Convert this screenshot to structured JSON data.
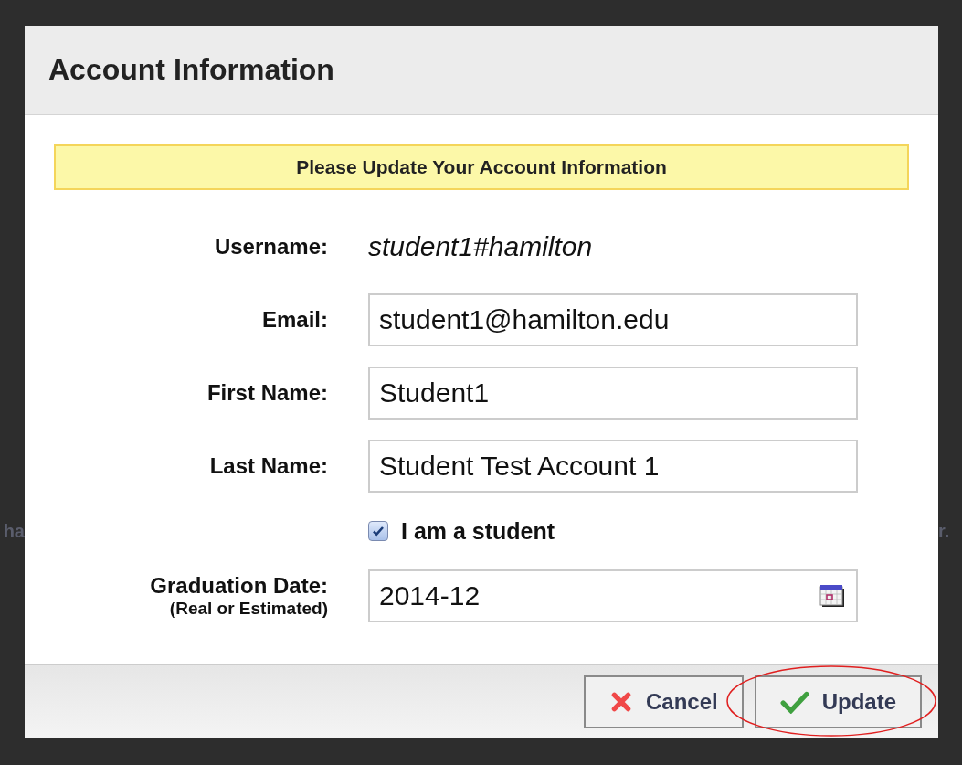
{
  "background_fragments": {
    "left": "ha",
    "right": "r."
  },
  "dialog": {
    "title": "Account Information",
    "notice": "Please Update Your Account Information",
    "fields": [
      {
        "kind": "static",
        "label": "Username:",
        "value": "student1#hamilton"
      },
      {
        "kind": "input",
        "label": "Email:",
        "value": "student1@hamilton.edu"
      },
      {
        "kind": "input",
        "label": "First Name:",
        "value": "Student1"
      },
      {
        "kind": "input",
        "label": "Last Name:",
        "value": "Student Test Account 1"
      },
      {
        "kind": "checkbox",
        "label": "I am a student",
        "checked": true
      },
      {
        "kind": "date",
        "label": "Graduation Date:",
        "sublabel": "(Real or Estimated)",
        "value": "2014-12"
      }
    ],
    "buttons": [
      {
        "kind": "cancel",
        "label": "Cancel",
        "highlighted": false
      },
      {
        "kind": "update",
        "label": "Update",
        "highlighted": true
      }
    ]
  }
}
